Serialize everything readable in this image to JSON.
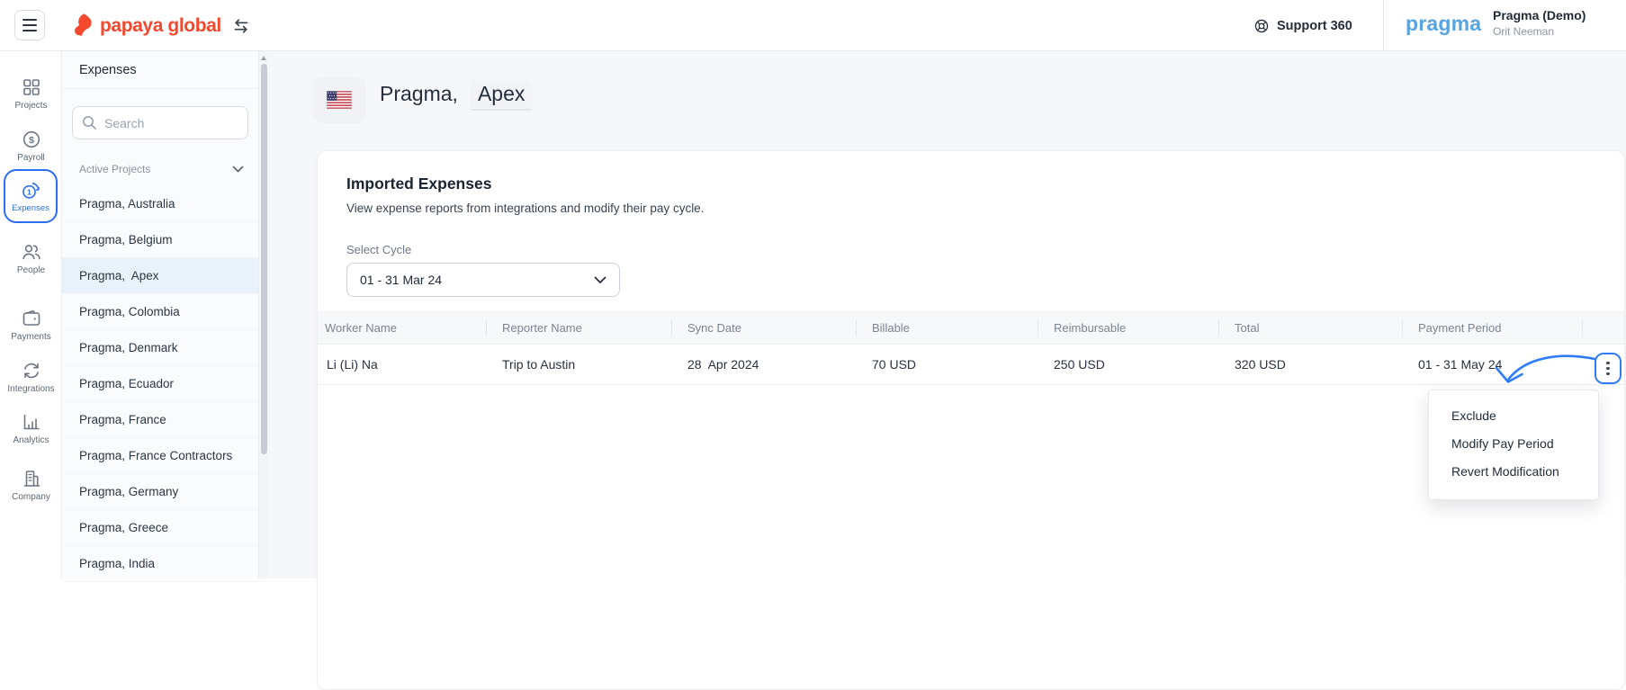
{
  "top_bar": {
    "logo_text": "papaya global",
    "support_label": "Support 360",
    "brand": "pragma",
    "account_name": "Pragma (Demo)",
    "account_user": "Orit Neeman"
  },
  "nav_rail": {
    "items": [
      {
        "label": "Projects",
        "icon": "grid-icon",
        "active": false
      },
      {
        "label": "Payroll",
        "icon": "payroll-icon",
        "active": false
      },
      {
        "label": "Expenses",
        "icon": "expenses-icon",
        "active": true
      },
      {
        "label": "People",
        "icon": "people-icon",
        "active": false
      },
      {
        "label": "Payments",
        "icon": "payments-icon",
        "active": false
      },
      {
        "label": "Integrations",
        "icon": "integrations-icon",
        "active": false
      },
      {
        "label": "Analytics",
        "icon": "analytics-icon",
        "active": false
      },
      {
        "label": "Company",
        "icon": "company-icon",
        "active": false
      }
    ]
  },
  "sidebar": {
    "title": "Expenses",
    "search_placeholder": "Search",
    "group_label": "Active Projects",
    "items": [
      "Pragma, Australia",
      "Pragma, Belgium",
      "Pragma,  Apex",
      "Pragma, Colombia",
      "Pragma, Denmark",
      "Pragma, Ecuador",
      "Pragma, France",
      "Pragma, France Contractors",
      "Pragma, Germany",
      "Pragma, Greece",
      "Pragma, India"
    ],
    "selected_index": 2
  },
  "main": {
    "title_prefix": "Pragma,",
    "title_suffix": "Apex",
    "flag": "us-flag",
    "card": {
      "title": "Imported Expenses",
      "subtitle": "View expense reports from integrations and modify their pay cycle.",
      "cycle_label": "Select Cycle",
      "cycle_value": "01 - 31 Mar 24",
      "table": {
        "columns": [
          "Worker Name",
          "Reporter Name",
          "Sync Date",
          "Billable",
          "Reimbursable",
          "Total",
          "Payment Period"
        ],
        "rows": [
          {
            "worker": "Li (Li) Na",
            "reporter": "Trip to Austin",
            "sync_date": "28  Apr 2024",
            "billable": "70 USD",
            "reimbursable": "250 USD",
            "total": "320 USD",
            "payment_period": "01 - 31 May 24"
          }
        ]
      }
    },
    "context_menu": {
      "items": [
        "Exclude",
        "Modify Pay Period",
        "Revert Modification"
      ]
    }
  },
  "colors": {
    "accent_blue": "#2f7df6",
    "rail_active_blue": "#2b6ef2",
    "brand_red": "#f4492e",
    "pragma_blue": "#57a4e0",
    "selected_row_bg": "#e9f1fa",
    "main_bg": "#f6f7f9",
    "table_header_bg": "#f7f8fa"
  }
}
